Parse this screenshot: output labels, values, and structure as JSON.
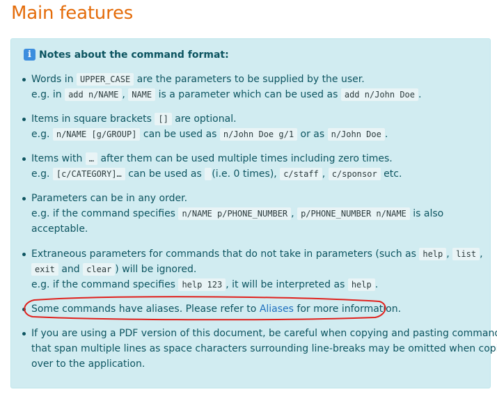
{
  "title": "Main features",
  "notes": {
    "heading": "Notes about the command format:",
    "icon": "info-icon",
    "items": [
      {
        "l1": {
          "a": "Words in ",
          "c1": "UPPER_CASE",
          "b": " are the parameters to be supplied by the user."
        },
        "l2": {
          "a": "e.g. in ",
          "c1": "add n/NAME",
          "b": ", ",
          "c2": "NAME",
          "c": " is a parameter which can be used as ",
          "c3": "add n/John Doe",
          "d": "."
        }
      },
      {
        "l1": {
          "a": "Items in square brackets ",
          "c1": "[]",
          "b": " are optional."
        },
        "l2": {
          "a": "e.g. ",
          "c1": "n/NAME [g/GROUP]",
          "b": " can be used as ",
          "c2": "n/John Doe g/1",
          "c": " or as ",
          "c3": "n/John Doe",
          "d": "."
        }
      },
      {
        "l1": {
          "a": "Items with ",
          "c1": "…",
          "b": " after them can be used multiple times including zero times."
        },
        "l2": {
          "a": "e.g. ",
          "c1": "[c/CATEGORY]…",
          "b": " can be used as ",
          "c2": " ",
          "c": " (i.e. 0 times), ",
          "c3": "c/staff",
          "d": ", ",
          "c4": "c/sponsor",
          "e": " etc."
        }
      },
      {
        "l1": {
          "a": "Parameters can be in any order."
        },
        "l2": {
          "a": "e.g. if the command specifies ",
          "c1": "n/NAME p/PHONE_NUMBER",
          "b": ", ",
          "c2": "p/PHONE_NUMBER n/NAME",
          "c": " is also"
        },
        "l3": {
          "a": "acceptable."
        }
      },
      {
        "l1": {
          "a": "Extraneous parameters for commands that do not take in parameters (such as ",
          "c1": "help",
          "b": ", ",
          "c2": "list",
          "c": ","
        },
        "l2": {
          "c1": "exit",
          "a": " and ",
          "c2": "clear",
          "b": ") will be ignored."
        },
        "l3": {
          "a": "e.g. if the command specifies ",
          "c1": "help 123",
          "b": ", it will be interpreted as ",
          "c2": "help",
          "c": "."
        }
      },
      {
        "l1": {
          "a": "Some commands have aliases. Please refer to ",
          "link": "Aliases",
          "b": " for more information."
        }
      },
      {
        "l1": {
          "a": "If you are using a PDF version of this document, be careful when copying and pasting commands"
        },
        "l2": {
          "a": "that span multiple lines as space characters surrounding line-breaks may be omitted when copied"
        },
        "l3": {
          "a": "over to the application."
        }
      }
    ]
  },
  "annotation": {
    "color": "#e0201c",
    "shape": "hand-drawn-ellipse"
  }
}
